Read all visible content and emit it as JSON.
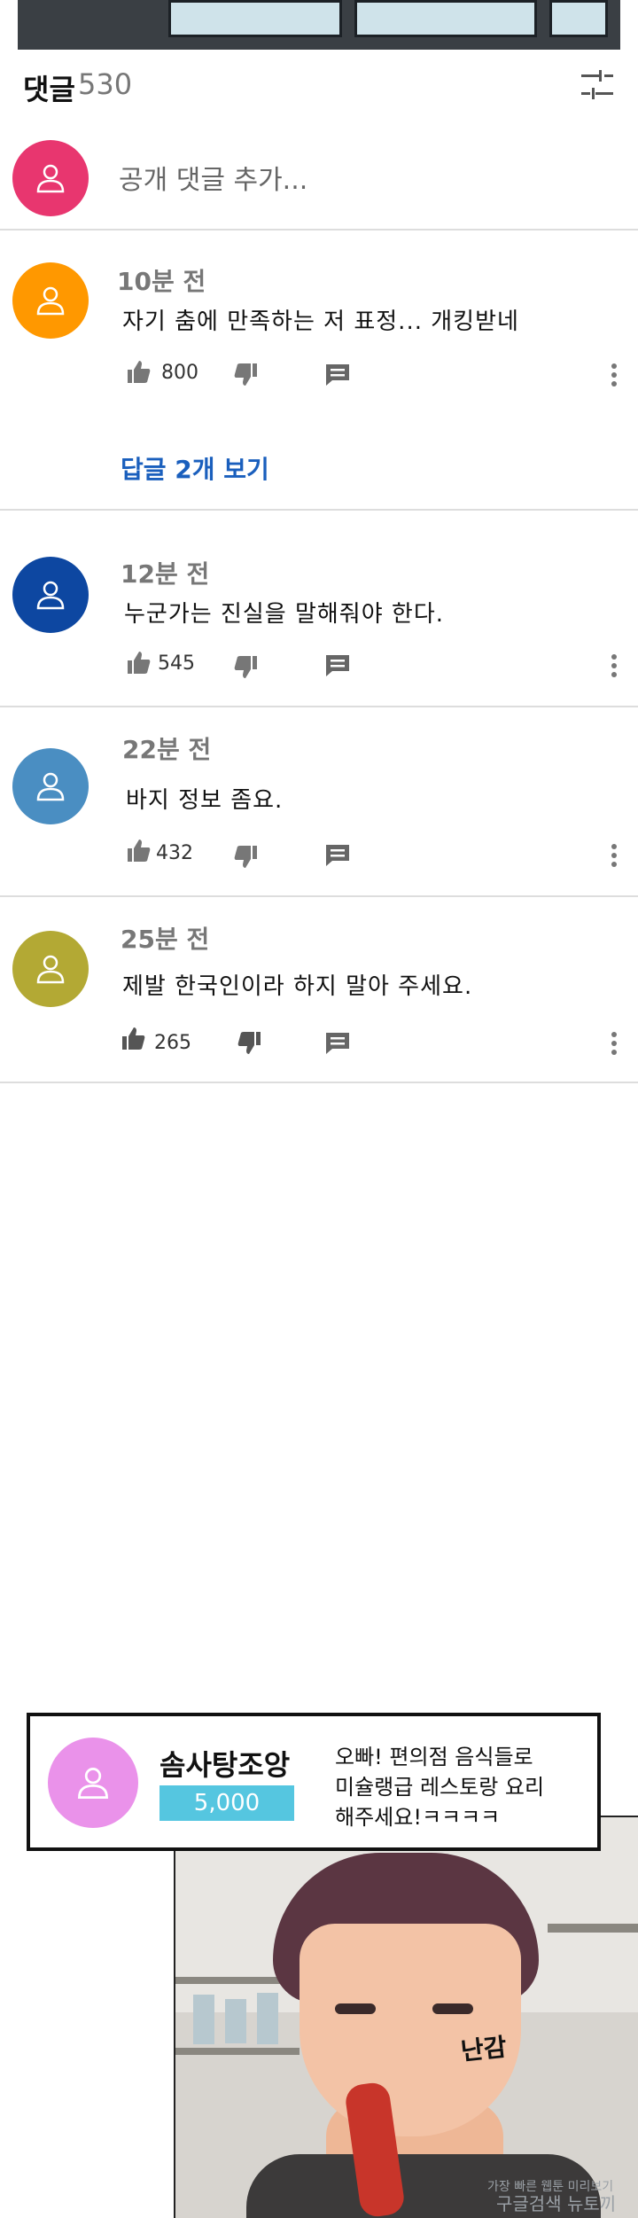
{
  "header": {
    "title": "댓글",
    "count": "530"
  },
  "add_comment": {
    "placeholder": "공개 댓글 추가..."
  },
  "colors": {
    "accent_link": "#1a5fbd",
    "divider": "#dddddd"
  },
  "comments": [
    {
      "time": "10분 전",
      "text": "자기 춤에 만족하는 저 표정... 개킹받네",
      "likes": "800",
      "avatar_color": "#ff9800",
      "replies": "답글 2개 보기"
    },
    {
      "time": "12분 전",
      "text": "누군가는 진실을 말해줘야 한다.",
      "likes": "545",
      "avatar_color": "#0d47a1"
    },
    {
      "time": "22분 전",
      "text": "바지 정보 좀요.",
      "likes": "432",
      "avatar_color": "#4a8ec2"
    },
    {
      "time": "25분 전",
      "text": "제발 한국인이라 하지 말아 주세요.",
      "likes": "265",
      "avatar_color": "#b3a934"
    }
  ],
  "promo": {
    "name": "솜사탕조앙",
    "badge": "5,000",
    "message_lines": [
      "오빠! 편의점 음식들로",
      "미슐랭급 레스토랑 요리",
      "해주세요!ㅋㅋㅋㅋ"
    ]
  },
  "comic": {
    "sfx": "난감",
    "watermark_top": "가장 빠른 웹툰 미리보기",
    "watermark_bottom": "구글검색 뉴토끼"
  },
  "icons": [
    "filter-icon",
    "user-icon",
    "thumb-up-icon",
    "thumb-down-icon",
    "reply-icon",
    "more-icon"
  ]
}
